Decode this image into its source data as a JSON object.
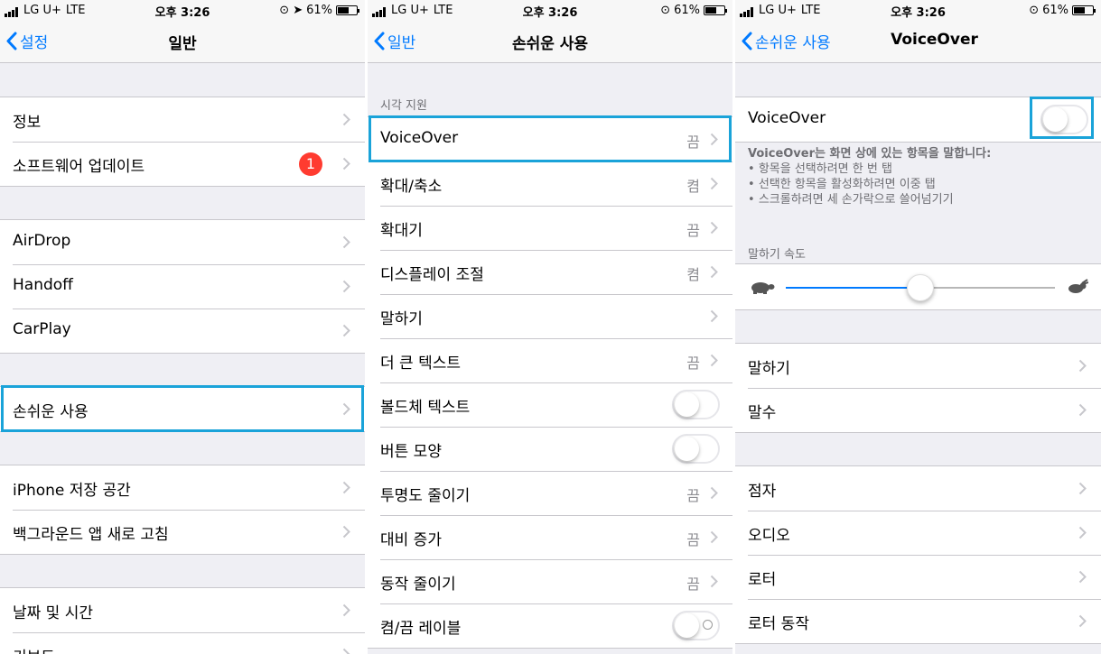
{
  "status": {
    "carrier": "LG U+",
    "network": "LTE",
    "time": "오후 3:26",
    "battery": "61%",
    "battery_level": 0.61
  },
  "screen1": {
    "nav": {
      "back": "설정",
      "title": "일반"
    },
    "group1": [
      {
        "label": "정보"
      },
      {
        "label": "소프트웨어 업데이트",
        "badge": "1"
      }
    ],
    "group2": [
      {
        "label": "AirDrop"
      },
      {
        "label": "Handoff"
      },
      {
        "label": "CarPlay"
      }
    ],
    "group3": [
      {
        "label": "손쉬운 사용"
      }
    ],
    "group4": [
      {
        "label": "iPhone 저장 공간"
      },
      {
        "label": "백그라운드 앱 새로 고침"
      }
    ],
    "group5": [
      {
        "label": "날짜 및 시간"
      },
      {
        "label": "키보드"
      }
    ]
  },
  "screen2": {
    "nav": {
      "back": "일반",
      "title": "손쉬운 사용"
    },
    "section_header": "시각 지원",
    "rows": [
      {
        "label": "VoiceOver",
        "value": "끔"
      },
      {
        "label": "확대/축소",
        "value": "켬"
      },
      {
        "label": "확대기",
        "value": "끔"
      },
      {
        "label": "디스플레이 조절",
        "value": "켬"
      },
      {
        "label": "말하기",
        "value": ""
      },
      {
        "label": "더 큰 텍스트",
        "value": "끔"
      },
      {
        "label": "볼드체 텍스트",
        "toggle": false
      },
      {
        "label": "버튼 모양",
        "toggle": false
      },
      {
        "label": "투명도 줄이기",
        "value": "끔"
      },
      {
        "label": "대비 증가",
        "value": "끔"
      },
      {
        "label": "동작 줄이기",
        "value": "끔"
      },
      {
        "label": "켬/끔 레이블",
        "toggle": false
      }
    ]
  },
  "screen3": {
    "nav": {
      "back": "손쉬운 사용",
      "title": "VoiceOver"
    },
    "voiceover_label": "VoiceOver",
    "voiceover_on": false,
    "description": {
      "title": "VoiceOver는 화면 상에 있는 항목을 말합니다:",
      "items": [
        "항목을 선택하려면 한 번 탭",
        "선택한 항목을 활성화하려면 이중 탭",
        "스크롤하려면 세 손가락으로 쓸어넘기기"
      ]
    },
    "speech_rate_header": "말하기 속도",
    "speech_rate": 0.5,
    "group2": [
      {
        "label": "말하기"
      },
      {
        "label": "말수"
      }
    ],
    "group3": [
      {
        "label": "점자"
      },
      {
        "label": "오디오"
      },
      {
        "label": "로터"
      },
      {
        "label": "로터 동작"
      }
    ]
  },
  "colors": {
    "accent": "#007aff",
    "highlight": "#1aa3d9",
    "badge": "#ff3b30",
    "background": "#efeff4"
  },
  "icons": [
    "back-chevron-icon",
    "chevron-right-icon",
    "signal-icon",
    "lock-rotation-icon",
    "location-icon",
    "battery-icon",
    "turtle-icon",
    "rabbit-icon"
  ]
}
